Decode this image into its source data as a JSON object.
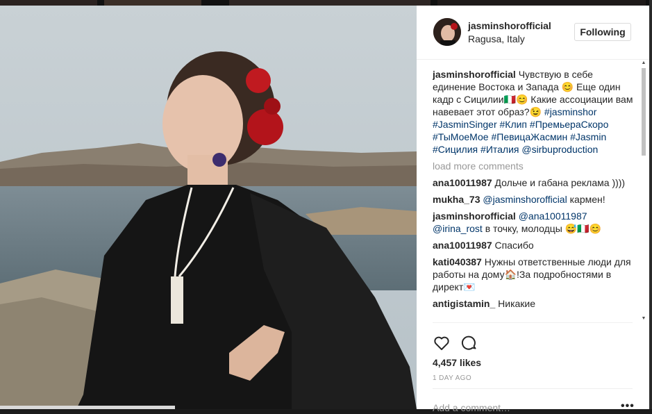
{
  "post": {
    "username": "jasminshorofficial",
    "location": "Ragusa, Italy",
    "follow_label": "Following",
    "likes": "4,457 likes",
    "time": "1 DAY AGO",
    "add_comment_placeholder": "Add a comment…"
  },
  "caption": {
    "username": "jasminshorofficial",
    "text": "Чувствую в себе единение Востока и Запада 😊 Еще один кадр с Сицилии🇮🇹😊 Какие ассоциации вам навевает этот образ?😉",
    "tags": [
      "#jasminshor",
      "#JasminSinger",
      "#Клип",
      "#ПремьераСкоро",
      "#ТыМоеМое",
      "#ПевицаЖасмин",
      "#Jasmin",
      "#Сицилия",
      "#Италия",
      "@sirbuproduction"
    ]
  },
  "load_more": "load more comments",
  "comments": [
    {
      "user": "ana10011987",
      "mention": "",
      "text": "Дольче и габана реклама ))))"
    },
    {
      "user": "mukha_73",
      "mention": "@jasminshorofficial",
      "text": "кармен!"
    },
    {
      "user": "jasminshorofficial",
      "mention": "@ana10011987 @irina_rost",
      "text": "в точку, молодцы 😅🇮🇹😊"
    },
    {
      "user": "ana10011987",
      "mention": "",
      "text": "Спасибо"
    },
    {
      "user": "kati040387",
      "mention": "",
      "text": "Нужны ответственные люди для работы на дому🏠!За подробностями в директ💌"
    },
    {
      "user": "antigistamin_",
      "mention": "",
      "text": "Никакие"
    }
  ],
  "icons": {
    "like": "heart-icon",
    "comment": "comment-bubble-icon",
    "more": "more-options-icon"
  },
  "colors": {
    "link": "#003569",
    "muted": "#999999",
    "text": "#262626"
  }
}
